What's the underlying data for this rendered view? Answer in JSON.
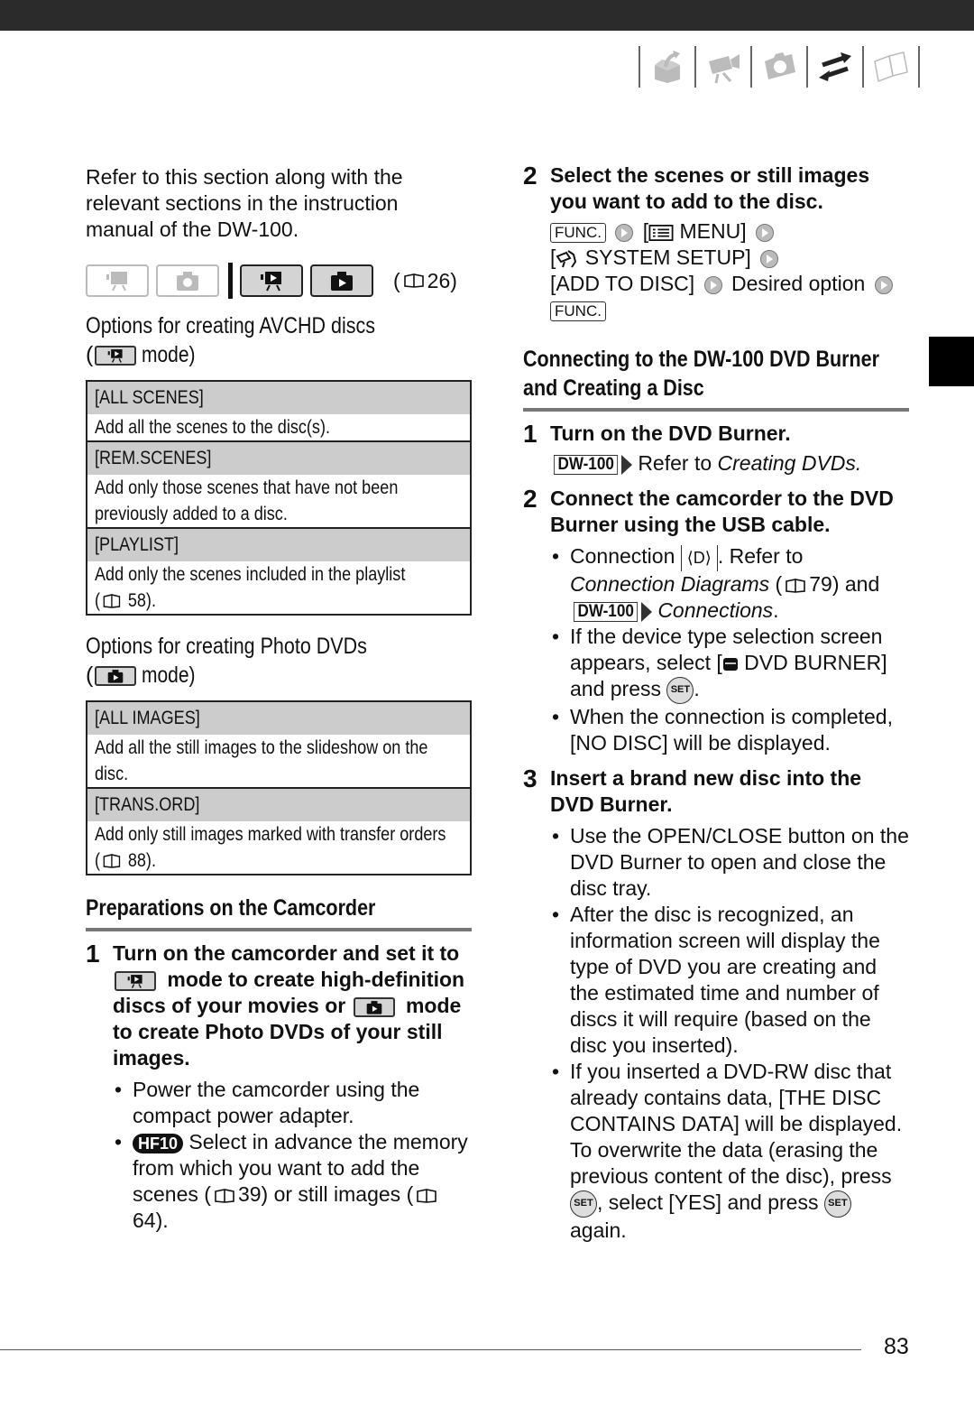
{
  "header": {
    "nav_icons": [
      "box-arrow-icon",
      "movie-camera-icon",
      "camera-icon",
      "transfer-arrows-icon",
      "book-icon"
    ],
    "active_nav_icon": "transfer-arrows-icon"
  },
  "left": {
    "intro": "Refer to this section along with the relevant sections in the instruction manual of the DW-100.",
    "mode_bar": {
      "modes": [
        {
          "name": "movie-record-mode",
          "active": false
        },
        {
          "name": "photo-record-mode",
          "active": false
        },
        {
          "name": "movie-playback-mode",
          "active": true
        },
        {
          "name": "photo-playback-mode",
          "active": true
        }
      ],
      "page_ref": "26"
    },
    "avchd": {
      "title": "Options for creating AVCHD discs",
      "mode_line_open": "(",
      "mode_line_close": "mode)",
      "options": [
        {
          "name": "[ALL SCENES]",
          "desc": "Add all the scenes to the disc(s)."
        },
        {
          "name": "[REM.SCENES]",
          "desc": "Add only those scenes that have not been previously added to a disc."
        },
        {
          "name": "[PLAYLIST]",
          "desc": "Add only the scenes included in the playlist",
          "ref": "58"
        }
      ]
    },
    "photo": {
      "title": "Options for creating Photo DVDs",
      "mode_line_open": "(",
      "mode_line_close": "mode)",
      "options": [
        {
          "name": "[ALL IMAGES]",
          "desc": "Add all the still images to the slideshow on the disc."
        },
        {
          "name": "[TRANS.ORD]",
          "desc": "Add only still images marked with transfer orders",
          "ref": "88"
        }
      ]
    },
    "prep": {
      "heading": "Preparations on the Camcorder",
      "step1": {
        "num": "1",
        "t1": "Turn on the camcorder and set it to",
        "t2": "mode to create high-definition discs of your movies or",
        "t3": "mode to create Photo DVDs of your still images.",
        "bullets": {
          "b1": "Power the camcorder using the compact power adapter.",
          "b2_badge": "HF10",
          "b2a": "Select in advance the memory from which you want to add the scenes (",
          "b2_ref1": "39",
          "b2b": ") or still images (",
          "b2_ref2": "64",
          "b2c": ")."
        }
      }
    }
  },
  "right": {
    "step2": {
      "num": "2",
      "title": "Select the scenes or still images you want to add to the disc.",
      "func_key": "FUNC.",
      "menu": "MENU]",
      "menu_open": "[",
      "system_setup": "SYSTEM SETUP]",
      "add_to_disc": "[ADD TO DISC]",
      "desired_option": "Desired option",
      "func_key2": "FUNC."
    },
    "connect": {
      "heading_l1": "Connecting to the DW-100 DVD Burner",
      "heading_l2": "and Creating a Disc",
      "step1": {
        "num": "1",
        "title": "Turn on the DVD Burner.",
        "dw_tag": "DW-100",
        "refer": "Refer to ",
        "refer_em": "Creating DVDs."
      },
      "step2": {
        "num": "2",
        "title": "Connect the camcorder to the DVD Burner using the USB cable.",
        "b1a": "Connection ",
        "b1_conn": "D",
        "b1b": ". Refer to ",
        "b1_em": "Connection Diagrams",
        "b1c": " (",
        "b1_ref": "79",
        "b1d": ") and",
        "b1_tag": "DW-100",
        "b1_em2": "Connections",
        "b1e": ".",
        "b2a": "If the device type selection screen appears, select [",
        "b2_item": " DVD BURNER]",
        "b2b": "and press ",
        "b2c": ".",
        "set": "SET",
        "b3": "When the connection is completed, [NO DISC] will be displayed."
      },
      "step3": {
        "num": "3",
        "title": "Insert a brand new disc into the DVD Burner.",
        "b1": "Use the OPEN/CLOSE button on the DVD Burner to open and close the disc tray.",
        "b2": "After the disc is recognized, an information screen will display the type of DVD you are creating and the estimated time and number of discs it will require (based on the disc you inserted).",
        "b3a": "If you inserted a DVD-RW disc that already contains data, [THE DISC CONTAINS DATA] will be displayed. To overwrite the data (erasing the previous content of the disc), press ",
        "b3b": ", select [YES] and press ",
        "b3c": " again.",
        "set": "SET"
      }
    }
  },
  "footer": {
    "page_number": "83"
  }
}
